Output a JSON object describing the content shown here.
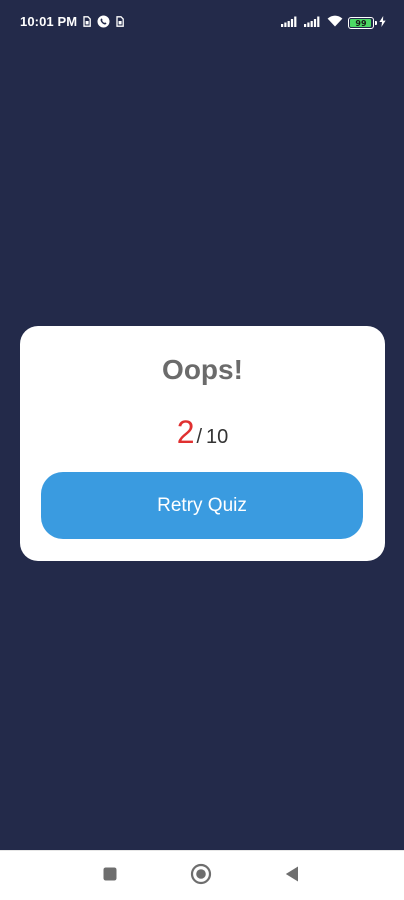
{
  "status_bar": {
    "time": "10:01 PM",
    "battery_level": "99",
    "icons": [
      "sim-icon",
      "whatsapp-call-icon",
      "sim-icon",
      "signal-icon",
      "signal-icon",
      "wifi-icon",
      "battery-icon",
      "charging-icon"
    ]
  },
  "result": {
    "title": "Oops!",
    "score": "2",
    "separator": "/",
    "total": "10",
    "retry_label": "Retry Quiz"
  },
  "nav_bar": {
    "icons": [
      "recents-icon",
      "home-icon",
      "back-icon"
    ]
  },
  "colors": {
    "background": "#232a4a",
    "card": "#ffffff",
    "title": "#6b6b6b",
    "score": "#e03030",
    "button": "#3a9be0",
    "battery": "#4cd964"
  }
}
